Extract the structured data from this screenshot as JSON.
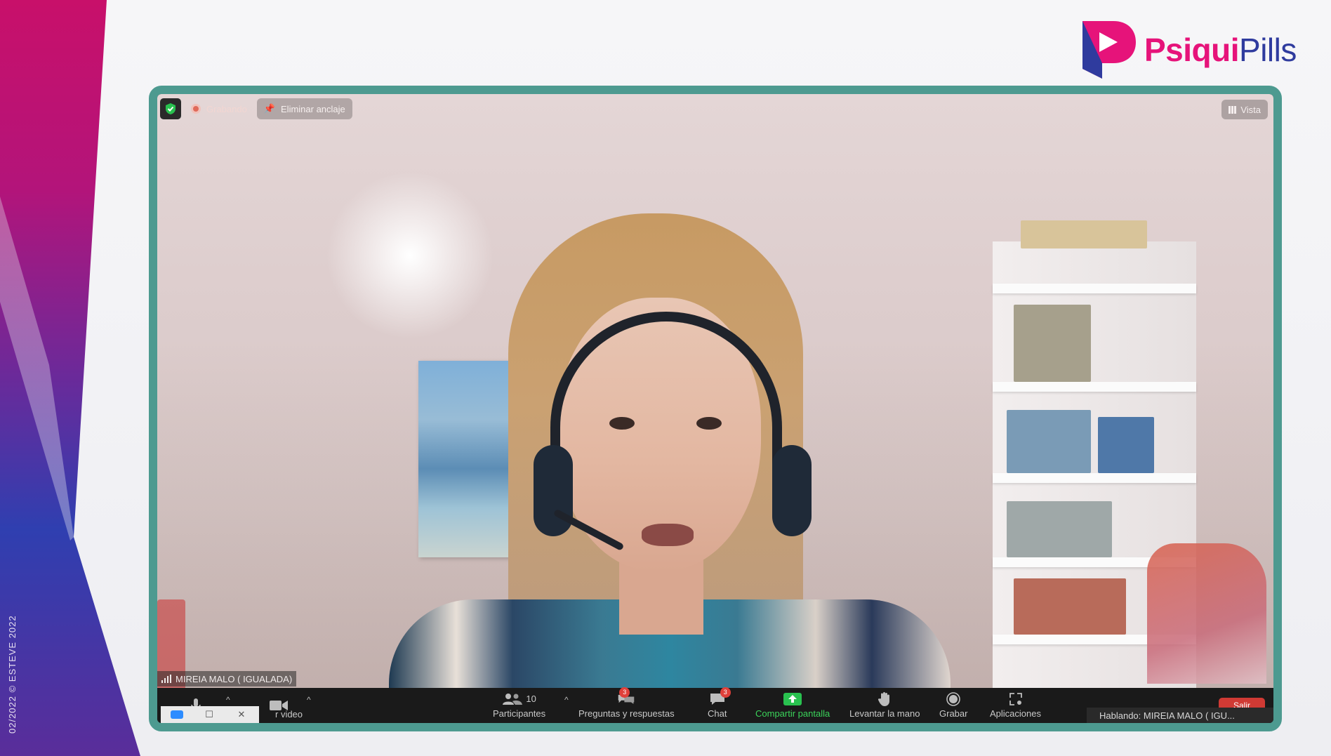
{
  "brand": {
    "name_bold": "Psiqui",
    "name_light": "Pills",
    "copyright": "02/2022 © ESTEVE 2022",
    "colors": {
      "magenta": "#e6137a",
      "navy": "#2f3b9e",
      "frame": "#4d9a90"
    }
  },
  "meeting": {
    "recording_label": "Grabando",
    "unpin_label": "Eliminar anclaje",
    "view_label": "Vista",
    "participant_name": "MIREIA MALO ( IGUALADA)",
    "speaking_label": "Hablando: MIREIA MALO ( IGU..."
  },
  "toolbar": {
    "video_label": "r video",
    "participants_label": "Participantes",
    "participants_count": "10",
    "qa_label": "Preguntas y respuestas",
    "qa_badge": "3",
    "chat_label": "Chat",
    "chat_badge": "3",
    "share_label": "Compartir pantalla",
    "raise_hand_label": "Levantar la mano",
    "record_label": "Grabar",
    "apps_label": "Aplicaciones",
    "leave_label": "Salir"
  },
  "icons": [
    "shield-icon",
    "record-icon",
    "pin-icon",
    "grid-icon",
    "signal-icon",
    "microphone-icon",
    "video-camera-icon",
    "participants-icon",
    "qa-icon",
    "chat-icon",
    "share-screen-icon",
    "raise-hand-icon",
    "record-button-icon",
    "apps-icon"
  ]
}
